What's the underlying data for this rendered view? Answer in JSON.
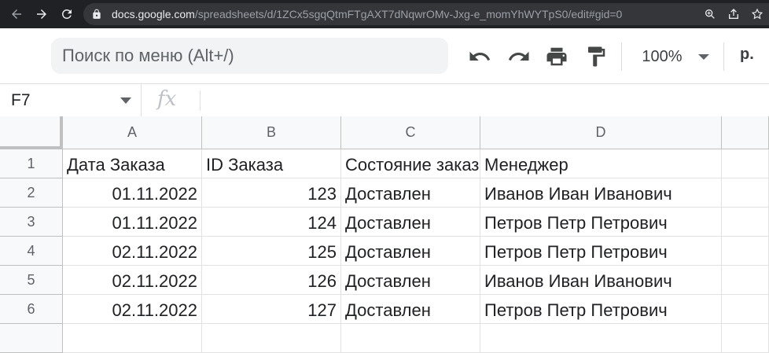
{
  "browser": {
    "url_host": "docs.google.com",
    "url_path": "/spreadsheets/d/1ZCx5sgqQtmFTgAXT7dNqwrOMv-Jxg-e_momYhWYTpS0/edit#gid=0"
  },
  "toolbar": {
    "menu_search_placeholder": "Поиск по меню (Alt+/)",
    "zoom": "100%",
    "currency": "р."
  },
  "formula_bar": {
    "cell_ref": "F7",
    "fx_label": "fx",
    "value": ""
  },
  "grid": {
    "columns": [
      "A",
      "B",
      "C",
      "D"
    ],
    "rows": [
      "1",
      "2",
      "3",
      "4",
      "5",
      "6"
    ],
    "cells": [
      [
        "Дата Заказа",
        "ID Заказа",
        "Состояние заказа",
        "Менеджер"
      ],
      [
        "01.11.2022",
        "123",
        "Доставлен",
        "Иванов Иван Иванович"
      ],
      [
        "01.11.2022",
        "124",
        "Доставлен",
        "Петров Петр Петрович"
      ],
      [
        "02.11.2022",
        "125",
        "Доставлен",
        "Петров Петр Петрович"
      ],
      [
        "02.11.2022",
        "126",
        "Доставлен",
        "Иванов Иван Иванович"
      ],
      [
        "02.11.2022",
        "127",
        "Доставлен",
        "Петров Петр Петрович"
      ]
    ]
  },
  "icons": {
    "back": "arrow-left-icon",
    "forward": "arrow-right-icon",
    "reload": "reload-icon",
    "lock": "lock-icon",
    "zoom": "zoom-icon",
    "share": "share-icon",
    "bookmark": "star-icon",
    "undo": "undo-icon",
    "redo": "redo-icon",
    "print": "print-icon",
    "paint_format": "paint-format-icon"
  }
}
